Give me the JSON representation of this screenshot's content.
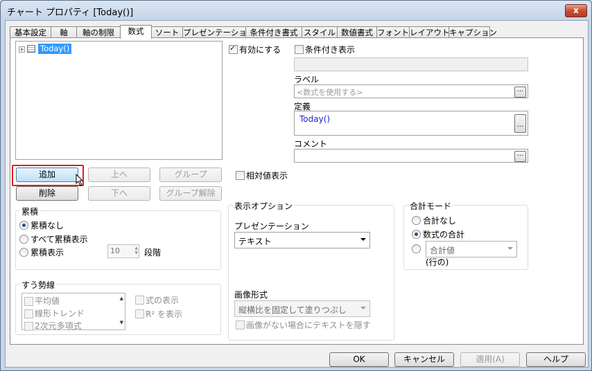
{
  "window": {
    "title": "チャート プロパティ [Today()]",
    "close_glyph": "x"
  },
  "tabs": [
    "基本設定",
    "軸",
    "軸の制限",
    "数式",
    "ソート",
    "プレゼンテーション",
    "条件付き書式",
    "スタイル",
    "数値書式",
    "フォント",
    "レイアウト",
    "キャプション"
  ],
  "active_tab": "数式",
  "expression_tree": {
    "expand_glyph": "+",
    "items": [
      "Today()"
    ]
  },
  "buttons": {
    "add": "追加",
    "up": "上へ",
    "group": "グループ",
    "delete": "削除",
    "down": "下へ",
    "ungroup": "グループ解除"
  },
  "enable": {
    "label": "有効にする",
    "checked": true
  },
  "conditional_display": {
    "label": "条件付き表示",
    "checked": false
  },
  "label_field": {
    "label": "ラベル",
    "placeholder": "<数式を使用する>"
  },
  "definition": {
    "label": "定義",
    "value": "Today()"
  },
  "comment": {
    "label": "コメント",
    "value": ""
  },
  "relative": {
    "label": "相対値表示",
    "checked": false
  },
  "accumulation": {
    "title": "累積",
    "options": [
      "累積なし",
      "すべて累積表示",
      "累積表示"
    ],
    "selected": 0,
    "steps_value": "10",
    "steps_unit": "段階"
  },
  "trendlines": {
    "title": "すう勢線",
    "items": [
      "平均値",
      "線形トレンド",
      "2次元多項式"
    ],
    "show_formula": "式の表示",
    "show_r2": "R² を表示"
  },
  "display_options": {
    "title": "表示オプション",
    "presentation_label": "プレゼンテーション",
    "presentation_value": "テキスト",
    "image_label": "画像形式",
    "image_value": "縦横比を固定して塗りつぶし",
    "hide_text_label": "画像がない場合にテキストを隠す"
  },
  "total_mode": {
    "title": "合計モード",
    "options": [
      "合計なし",
      "数式の合計"
    ],
    "selected": 1,
    "combo_value": "合計値",
    "combo_suffix": "(行の)"
  },
  "footer": {
    "ok": "OK",
    "cancel": "キャンセル",
    "apply": "適用(A)",
    "help": "ヘルプ"
  },
  "colors": {
    "highlight": "#3399ff",
    "focus_ring": "#e02020",
    "definition_text": "#1f1fd0"
  }
}
